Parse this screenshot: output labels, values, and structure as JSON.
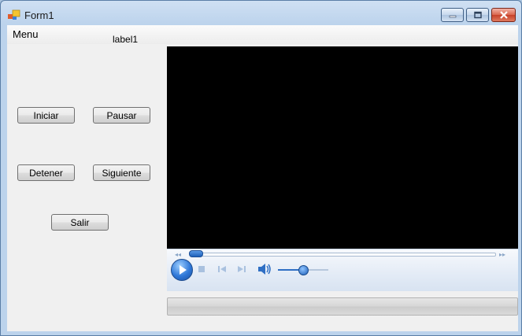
{
  "window": {
    "title": "Form1",
    "icon": "winforms-app-icon",
    "controls": [
      "minimize-icon",
      "maximize-icon",
      "close-icon"
    ]
  },
  "menu": {
    "items": [
      "Menu"
    ]
  },
  "label1": "label1",
  "buttons": {
    "iniciar": "Iniciar",
    "pausar": "Pausar",
    "detener": "Detener",
    "siguiente": "Siguiente",
    "salir": "Salir"
  },
  "player": {
    "seek_position": 0,
    "volume": 0.5,
    "controls": [
      "play-icon",
      "stop-icon",
      "previous-icon",
      "next-icon",
      "speaker-icon"
    ]
  },
  "progress": {
    "value": 0
  },
  "colors": {
    "accent": "#2f78d8",
    "video_background": "#000000"
  }
}
